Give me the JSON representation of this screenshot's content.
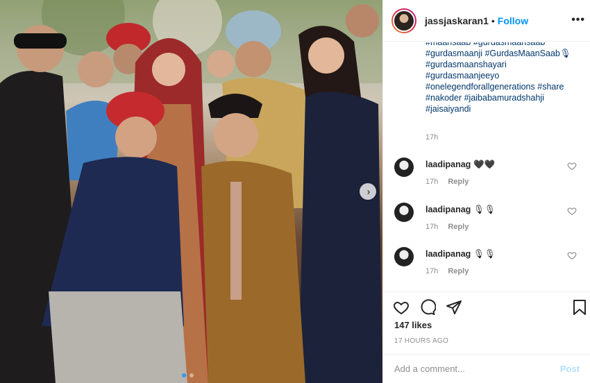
{
  "post": {
    "carousel": {
      "slide_count": 2,
      "active_slide": 1
    }
  },
  "header": {
    "username": "jassjaskaran1",
    "separator": "•",
    "follow_label": "Follow",
    "more_label": "•••"
  },
  "caption": {
    "lines": [
      "#maansaab #gurdasmaansaab",
      "#gurdasmaanji #GurdasMaanSaab🎙",
      "#gurdasmaanshayari",
      "#gurdasmaanjeeyo",
      "#onelegendforallgenerations #share",
      "#nakoder #jaibabamuradshahji",
      "#jaisaiyandi"
    ],
    "time": "17h"
  },
  "comments": [
    {
      "username": "laadipanag",
      "text": "🖤🖤",
      "time": "17h",
      "reply_label": "Reply"
    },
    {
      "username": "laadipanag",
      "text": "🎙🎙",
      "time": "17h",
      "reply_label": "Reply"
    },
    {
      "username": "laadipanag",
      "text": "🎙🎙",
      "time": "17h",
      "reply_label": "Reply"
    }
  ],
  "actions": {
    "like_icon": "heart-icon",
    "comment_icon": "comment-bubble-icon",
    "share_icon": "paper-plane-icon",
    "save_icon": "bookmark-icon"
  },
  "likes": "147 likes",
  "timeago": "17 HOURS AGO",
  "add_comment": {
    "placeholder": "Add a comment...",
    "post_label": "Post"
  },
  "colors": {
    "link": "#0095f6",
    "hashtag": "#00376b",
    "muted": "#8e8e8e",
    "post_disabled": "#b2dffc"
  }
}
